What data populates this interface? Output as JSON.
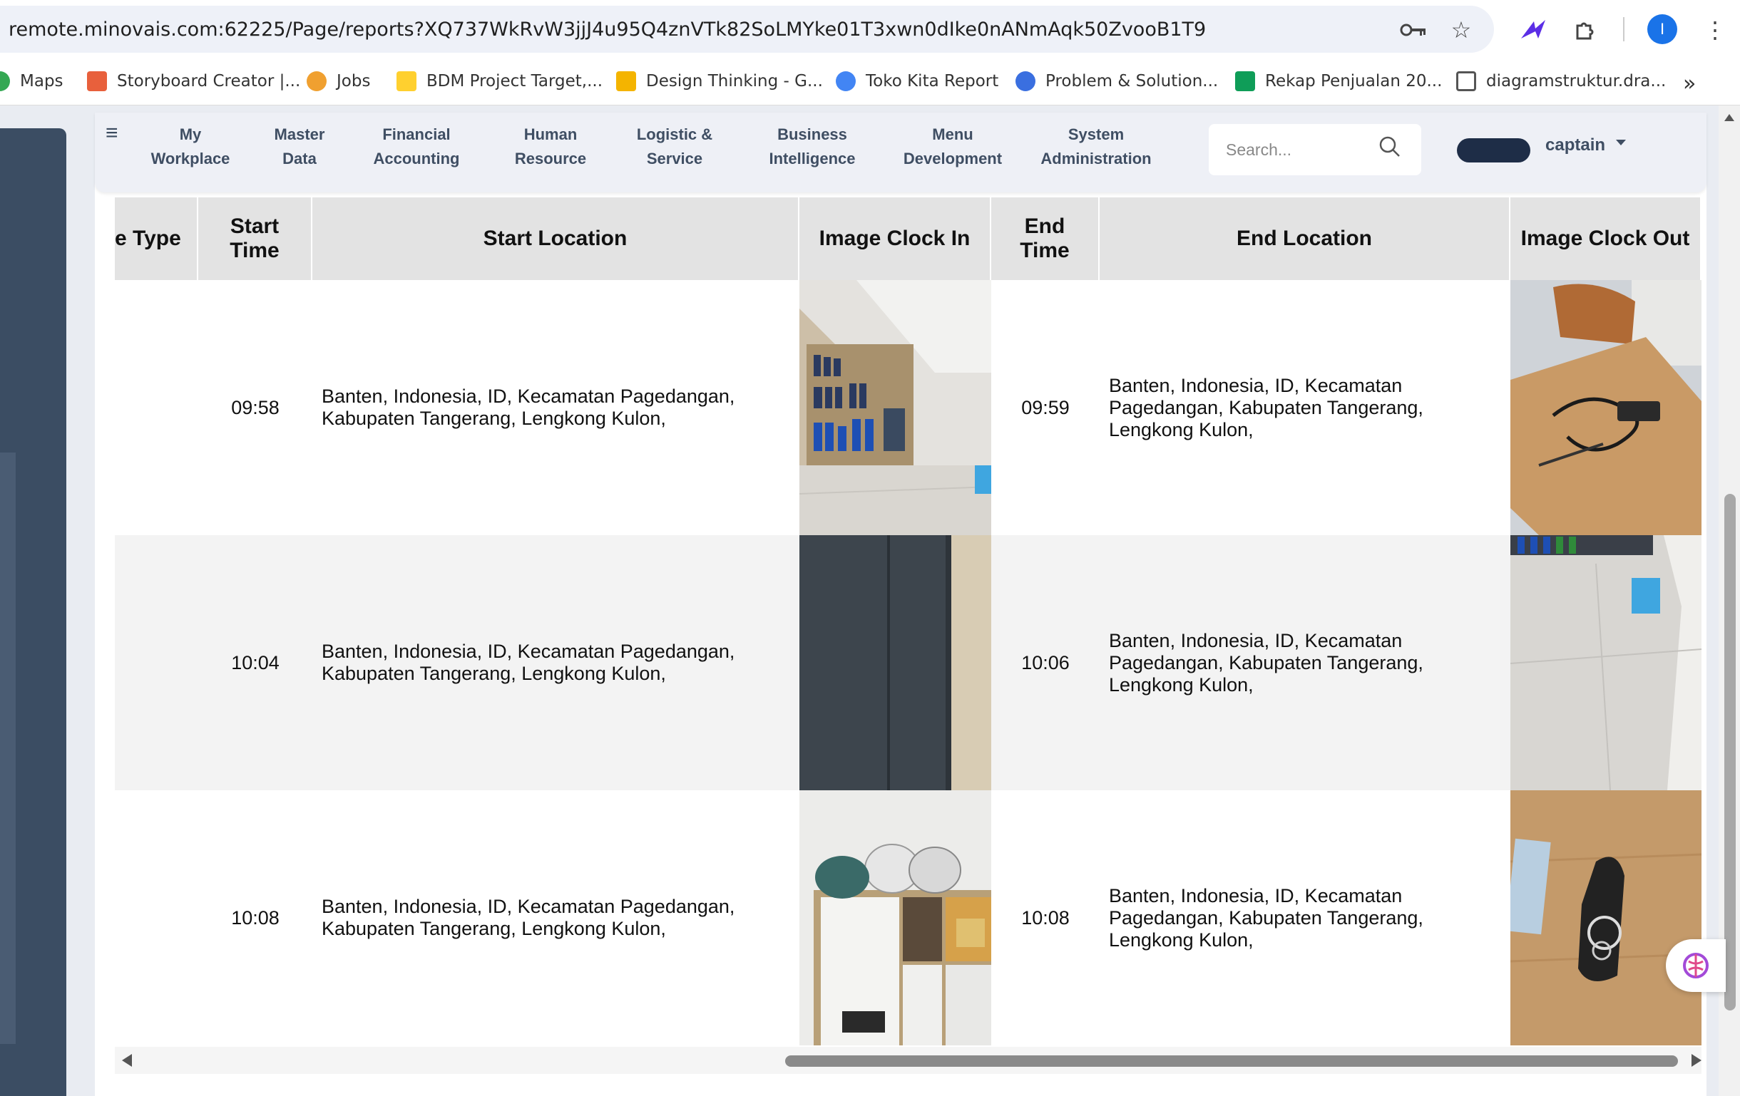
{
  "browser": {
    "url": "remote.minovais.com:62225/Page/reports?XQ737WkRvW3jjJ4u95Q4znVTk82SoLMYke01T3xwn0dIke0nANmAqk50ZvooB1T9",
    "profile_initial": "I",
    "bookmarks": [
      {
        "label": "Maps",
        "icon": "maps-pin-icon",
        "color": "#34a853"
      },
      {
        "label": "Storyboard Creator |...",
        "icon": "storyboard-icon",
        "color": "#e8603c"
      },
      {
        "label": "Jobs",
        "icon": "jobs-icon",
        "color": "#f0a030"
      },
      {
        "label": "BDM Project Target,...",
        "icon": "miro-icon",
        "color": "#ffd02f"
      },
      {
        "label": "Design Thinking - G...",
        "icon": "slides-icon",
        "color": "#f4b400"
      },
      {
        "label": "Toko Kita Report",
        "icon": "report-icon",
        "color": "#4285f4"
      },
      {
        "label": "Problem & Solution...",
        "icon": "canva-icon",
        "color": "#3a6fe0"
      },
      {
        "label": "Rekap Penjualan 20...",
        "icon": "sheets-icon",
        "color": "#0f9d58"
      },
      {
        "label": "diagramstruktur.dra...",
        "icon": "drawio-icon",
        "color": "#555555"
      }
    ]
  },
  "nav": {
    "items": [
      {
        "line1": "My",
        "line2": "Workplace"
      },
      {
        "line1": "Master",
        "line2": "Data"
      },
      {
        "line1": "Financial",
        "line2": "Accounting"
      },
      {
        "line1": "Human",
        "line2": "Resource"
      },
      {
        "line1": "Logistic &",
        "line2": "Service"
      },
      {
        "line1": "Business",
        "line2": "Intelligence"
      },
      {
        "line1": "Menu",
        "line2": "Development"
      },
      {
        "line1": "System",
        "line2": "Administration"
      }
    ],
    "search_placeholder": "Search...",
    "username": "captain"
  },
  "table": {
    "headers": {
      "type": "e Type",
      "start_time_1": "Start",
      "start_time_2": "Time",
      "start_location": "Start Location",
      "image_clock_in": "Image Clock In",
      "end_time_1": "End",
      "end_time_2": "Time",
      "end_location": "End Location",
      "image_clock_out": "Image Clock Out"
    },
    "rows": [
      {
        "start_time": "09:58",
        "start_location_1": "Banten, Indonesia, ID, Kecamatan Pagedangan,",
        "start_location_2": "Kabupaten Tangerang, Lengkong Kulon,",
        "end_time": "09:59",
        "end_location_1": "Banten, Indonesia, ID, Kecamatan",
        "end_location_2": "Pagedangan, Kabupaten Tangerang,",
        "end_location_3": "Lengkong Kulon,"
      },
      {
        "start_time": "10:04",
        "start_location_1": "Banten, Indonesia, ID, Kecamatan Pagedangan,",
        "start_location_2": "Kabupaten Tangerang, Lengkong Kulon,",
        "end_time": "10:06",
        "end_location_1": "Banten, Indonesia, ID, Kecamatan",
        "end_location_2": "Pagedangan, Kabupaten Tangerang,",
        "end_location_3": "Lengkong Kulon,"
      },
      {
        "start_time": "10:08",
        "start_location_1": "Banten, Indonesia, ID, Kecamatan Pagedangan,",
        "start_location_2": "Kabupaten Tangerang, Lengkong Kulon,",
        "end_time": "10:08",
        "end_location_1": "Banten, Indonesia, ID, Kecamatan",
        "end_location_2": "Pagedangan, Kabupaten Tangerang,",
        "end_location_3": "Lengkong Kulon,"
      }
    ]
  },
  "colors": {
    "nav_text": "#3f4e63",
    "sidebar": "#3b4d63",
    "row_alt": "#f3f3f3",
    "header_bg": "#e3e3e3"
  }
}
